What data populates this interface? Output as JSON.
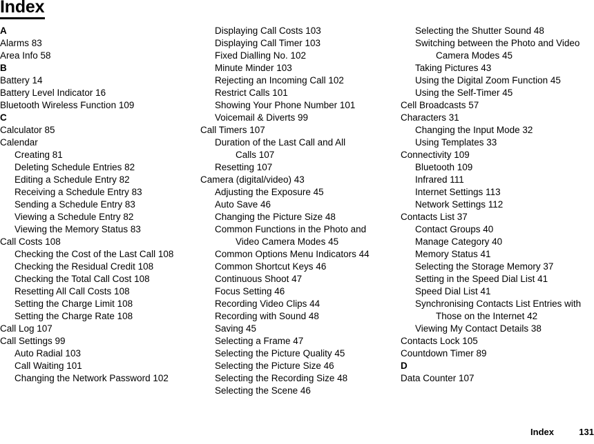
{
  "document": {
    "title": "Index",
    "footer": {
      "label": "Index",
      "page_number": "131"
    }
  },
  "columns": [
    {
      "id": "column-1",
      "blocks": [
        {
          "type": "letter",
          "text": "A"
        },
        {
          "type": "entry",
          "level": 0,
          "text": "Alarms 83"
        },
        {
          "type": "entry",
          "level": 0,
          "text": "Area Info 58"
        },
        {
          "type": "letter",
          "text": "B"
        },
        {
          "type": "entry",
          "level": 0,
          "text": "Battery 14"
        },
        {
          "type": "entry",
          "level": 0,
          "text": "Battery Level Indicator 16"
        },
        {
          "type": "entry",
          "level": 0,
          "text": "Bluetooth Wireless Function 109"
        },
        {
          "type": "letter",
          "text": "C"
        },
        {
          "type": "entry",
          "level": 0,
          "text": "Calculator 85"
        },
        {
          "type": "entry",
          "level": 0,
          "text": "Calendar"
        },
        {
          "type": "entry",
          "level": 1,
          "text": "Creating 81"
        },
        {
          "type": "entry",
          "level": 1,
          "text": "Deleting Schedule Entries 82"
        },
        {
          "type": "entry",
          "level": 1,
          "text": "Editing a Schedule Entry 82"
        },
        {
          "type": "entry",
          "level": 1,
          "text": "Receiving a Schedule Entry 83"
        },
        {
          "type": "entry",
          "level": 1,
          "text": "Sending a Schedule Entry 83"
        },
        {
          "type": "entry",
          "level": 1,
          "text": "Viewing a Schedule Entry 82"
        },
        {
          "type": "entry",
          "level": 1,
          "text": "Viewing the Memory Status 83"
        },
        {
          "type": "entry",
          "level": 0,
          "text": "Call Costs 108"
        },
        {
          "type": "entry",
          "level": 1,
          "text": "Checking the Cost of the Last Call 108"
        },
        {
          "type": "entry",
          "level": 1,
          "text": "Checking the Residual Credit 108"
        },
        {
          "type": "entry",
          "level": 1,
          "text": "Checking the Total Call Cost 108"
        },
        {
          "type": "entry",
          "level": 1,
          "text": "Resetting All Call Costs 108"
        },
        {
          "type": "entry",
          "level": 1,
          "text": "Setting the Charge Limit 108"
        },
        {
          "type": "entry",
          "level": 1,
          "text": "Setting the Charge Rate 108"
        },
        {
          "type": "entry",
          "level": 0,
          "text": "Call Log 107"
        },
        {
          "type": "entry",
          "level": 0,
          "text": "Call Settings 99"
        },
        {
          "type": "entry",
          "level": 1,
          "text": "Auto Radial 103"
        },
        {
          "type": "entry",
          "level": 1,
          "text": "Call Waiting 101"
        },
        {
          "type": "entry",
          "level": 1,
          "text": "Changing the Network Password 102"
        }
      ]
    },
    {
      "id": "column-2",
      "blocks": [
        {
          "type": "entry",
          "level": 1,
          "text": "Displaying Call Costs 103"
        },
        {
          "type": "entry",
          "level": 1,
          "text": "Displaying Call Timer 103"
        },
        {
          "type": "entry",
          "level": 1,
          "text": "Fixed Dialling No. 102"
        },
        {
          "type": "entry",
          "level": 1,
          "text": "Minute Minder 103"
        },
        {
          "type": "entry",
          "level": 1,
          "text": "Rejecting an Incoming Call 102"
        },
        {
          "type": "entry",
          "level": 1,
          "text": "Restrict Calls 101"
        },
        {
          "type": "entry",
          "level": 1,
          "text": "Showing Your Phone Number 101"
        },
        {
          "type": "entry",
          "level": 1,
          "text": "Voicemail & Diverts 99"
        },
        {
          "type": "entry",
          "level": 0,
          "text": "Call Timers 107"
        },
        {
          "type": "entry",
          "level": 1,
          "text": "Duration of the Last Call and All"
        },
        {
          "type": "entry",
          "level": 2,
          "text": "Calls 107"
        },
        {
          "type": "entry",
          "level": 1,
          "text": "Resetting 107"
        },
        {
          "type": "entry",
          "level": 0,
          "text": "Camera (digital/video) 43"
        },
        {
          "type": "entry",
          "level": 1,
          "text": "Adjusting the Exposure 45"
        },
        {
          "type": "entry",
          "level": 1,
          "text": "Auto Save 46"
        },
        {
          "type": "entry",
          "level": 1,
          "text": "Changing the Picture Size 48"
        },
        {
          "type": "entry",
          "level": 1,
          "text": "Common Functions in the Photo and"
        },
        {
          "type": "entry",
          "level": 2,
          "text": "Video Camera Modes 45"
        },
        {
          "type": "entry",
          "level": 1,
          "text": "Common Options Menu Indicators 44"
        },
        {
          "type": "entry",
          "level": 1,
          "text": "Common Shortcut Keys 46"
        },
        {
          "type": "entry",
          "level": 1,
          "text": "Continuous Shoot 47"
        },
        {
          "type": "entry",
          "level": 1,
          "text": "Focus Setting 46"
        },
        {
          "type": "entry",
          "level": 1,
          "text": "Recording Video Clips 44"
        },
        {
          "type": "entry",
          "level": 1,
          "text": "Recording with Sound 48"
        },
        {
          "type": "entry",
          "level": 1,
          "text": "Saving 45"
        },
        {
          "type": "entry",
          "level": 1,
          "text": "Selecting a Frame 47"
        },
        {
          "type": "entry",
          "level": 1,
          "text": "Selecting the Picture Quality 45"
        },
        {
          "type": "entry",
          "level": 1,
          "text": "Selecting the Picture Size 46"
        },
        {
          "type": "entry",
          "level": 1,
          "text": "Selecting the Recording Size 48"
        },
        {
          "type": "entry",
          "level": 1,
          "text": "Selecting the Scene 46"
        }
      ]
    },
    {
      "id": "column-3",
      "blocks": [
        {
          "type": "entry",
          "level": 1,
          "text": "Selecting the Shutter Sound 48"
        },
        {
          "type": "entry",
          "level": 1,
          "text": "Switching between the Photo and Video"
        },
        {
          "type": "entry",
          "level": 2,
          "text": "Camera Modes 45"
        },
        {
          "type": "entry",
          "level": 1,
          "text": "Taking Pictures 43"
        },
        {
          "type": "entry",
          "level": 1,
          "text": "Using the Digital Zoom Function 45"
        },
        {
          "type": "entry",
          "level": 1,
          "text": "Using the Self-Timer 45"
        },
        {
          "type": "entry",
          "level": 0,
          "text": "Cell Broadcasts 57"
        },
        {
          "type": "entry",
          "level": 0,
          "text": "Characters 31"
        },
        {
          "type": "entry",
          "level": 1,
          "text": "Changing the Input Mode 32"
        },
        {
          "type": "entry",
          "level": 1,
          "text": "Using Templates 33"
        },
        {
          "type": "entry",
          "level": 0,
          "text": "Connectivity 109"
        },
        {
          "type": "entry",
          "level": 1,
          "text": "Bluetooth 109"
        },
        {
          "type": "entry",
          "level": 1,
          "text": "Infrared 111"
        },
        {
          "type": "entry",
          "level": 1,
          "text": "Internet Settings 113"
        },
        {
          "type": "entry",
          "level": 1,
          "text": "Network Settings 112"
        },
        {
          "type": "entry",
          "level": 0,
          "text": "Contacts List 37"
        },
        {
          "type": "entry",
          "level": 1,
          "text": "Contact Groups 40"
        },
        {
          "type": "entry",
          "level": 1,
          "text": "Manage Category 40"
        },
        {
          "type": "entry",
          "level": 1,
          "text": "Memory Status 41"
        },
        {
          "type": "entry",
          "level": 1,
          "text": "Selecting the Storage Memory 37"
        },
        {
          "type": "entry",
          "level": 1,
          "text": "Setting in the Speed Dial List 41"
        },
        {
          "type": "entry",
          "level": 1,
          "text": "Speed Dial List 41"
        },
        {
          "type": "entry",
          "level": 1,
          "text": "Synchronising Contacts List Entries with"
        },
        {
          "type": "entry",
          "level": 2,
          "text": "Those on the Internet 42"
        },
        {
          "type": "entry",
          "level": 1,
          "text": "Viewing My Contact Details 38"
        },
        {
          "type": "entry",
          "level": 0,
          "text": "Contacts Lock 105"
        },
        {
          "type": "entry",
          "level": 0,
          "text": "Countdown Timer 89"
        },
        {
          "type": "letter",
          "text": "D"
        },
        {
          "type": "entry",
          "level": 0,
          "text": "Data Counter 107"
        }
      ]
    }
  ]
}
